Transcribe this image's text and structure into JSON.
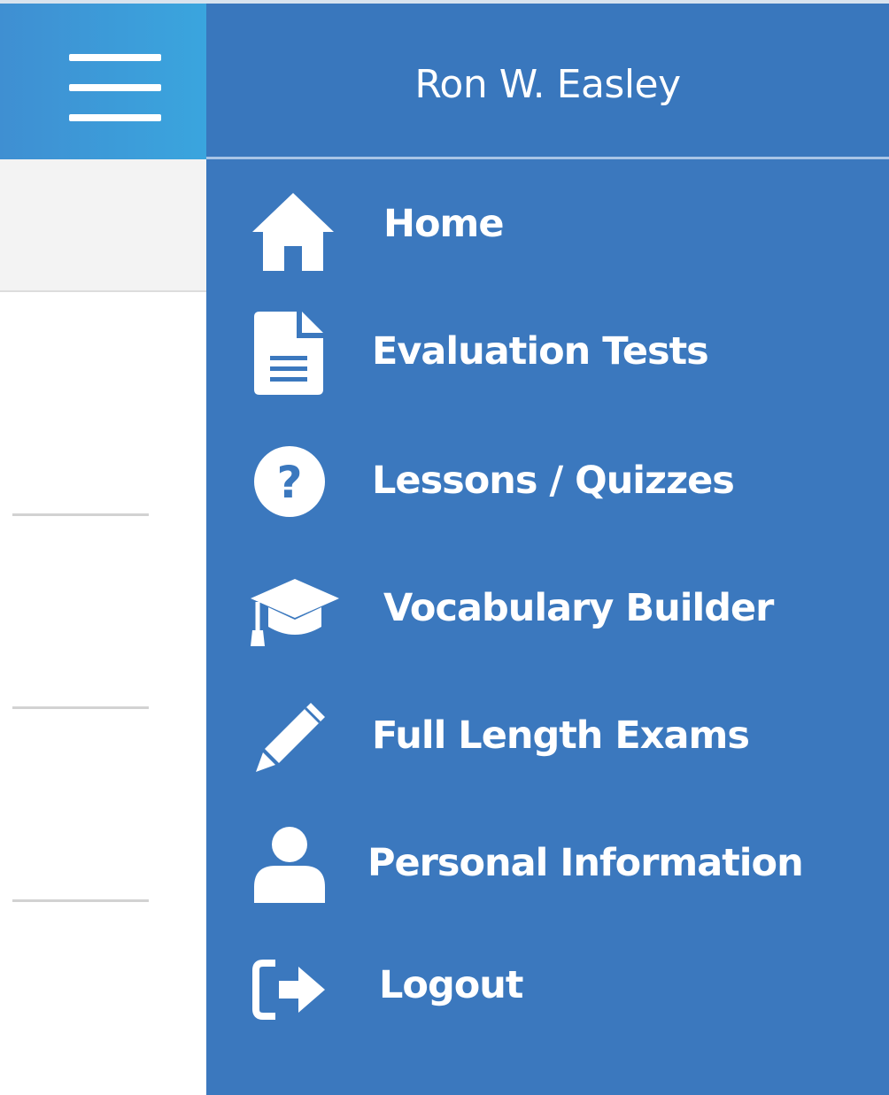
{
  "header": {
    "user_name": "Ron W. Easley",
    "menu_icon": "hamburger-menu-icon"
  },
  "nav": {
    "items": [
      {
        "label": "Home",
        "icon": "home-icon"
      },
      {
        "label": "Evaluation Tests",
        "icon": "document-icon"
      },
      {
        "label": "Lessons / Quizzes",
        "icon": "question-circle-icon"
      },
      {
        "label": "Vocabulary Builder",
        "icon": "graduation-cap-icon"
      },
      {
        "label": "Full Length Exams",
        "icon": "pencil-icon"
      },
      {
        "label": "Personal Information",
        "icon": "user-icon"
      },
      {
        "label": "Logout",
        "icon": "logout-icon"
      }
    ]
  },
  "colors": {
    "drawer_bg": "#3b78be",
    "header_gradient_start": "#3f8fd2",
    "header_gradient_end": "#3aa5de",
    "text": "#ffffff"
  }
}
